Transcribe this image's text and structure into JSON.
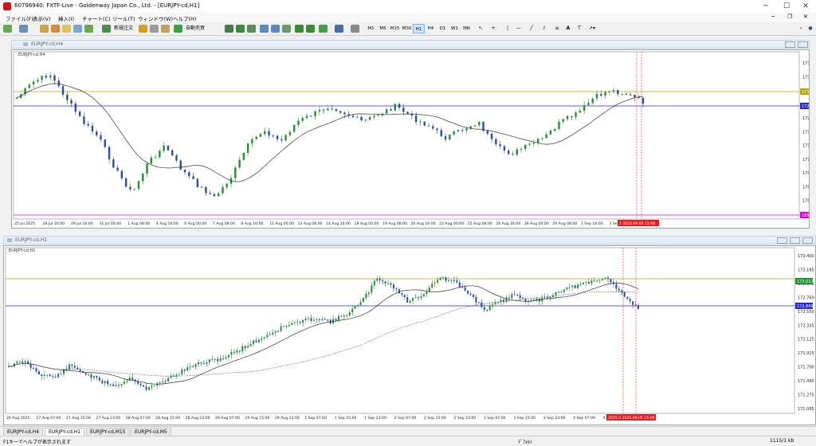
{
  "window": {
    "title": "60796940: FXTF-Live - Goldenway Japan Co., Ltd. - [EURJPY-cd,H1]",
    "minimize": "─",
    "maximize": "☐",
    "close": "✕"
  },
  "menu": [
    "ファイル(F)",
    "表示(V)",
    "挿入(I)",
    "チャート(C)",
    "ツール(T)",
    "ウィンドウ(W)",
    "ヘルプ(H)"
  ],
  "toolbar": {
    "new_order": "新規注文",
    "auto_trading": "自動売買",
    "timeframes": [
      "M1",
      "M5",
      "M15",
      "M30",
      "H1",
      "H4",
      "D1",
      "W1",
      "MN"
    ],
    "active_timeframe": "H1"
  },
  "top_window": {
    "mdi_title": "EURJPY-cd,H4",
    "chart_label": "EURJPY-cd,H4",
    "price_labels": [
      "173.40",
      "173.15",
      "172.80",
      "172.50",
      "172.20",
      "171.90",
      "171.55",
      "171.20",
      "170.90",
      "170.55",
      "170.25",
      "169.90"
    ],
    "time_labels": [
      "25 Jul 2025",
      "28 Jul 16:00",
      "29 Jul 16:00",
      "31 Jul 00:00",
      "1 Aug 08:00",
      "4 Aug 16:00",
      "6 Aug 00:00",
      "7 Aug 08:00",
      "8 Aug 16:00",
      "12 Aug 00:00",
      "13 Aug 08:00",
      "14 Aug 16:00",
      "18 Aug 00:00",
      "19 Aug 08:00",
      "20 Aug 16:00",
      "22 Aug 00:00",
      "25 Aug 08:00",
      "26 Aug 16:00",
      "28 Aug 00:00",
      "29 Aug 08:00",
      "1 Sep 16:00",
      "3 Sep 00:00",
      "4 Sep 08:00"
    ],
    "tags": {
      "yellow": "173.0",
      "blue": "172.6",
      "magenta": "169.7"
    },
    "time_marker": "2 2025.09.05 15:00"
  },
  "bottom_window": {
    "mdi_title": "EURJPY-cd,H1",
    "chart_label": "EURJPY-cd,H1",
    "price_labels": [
      "173.400",
      "173.185",
      "172.975",
      "172.760",
      "172.550",
      "172.335",
      "172.125",
      "171.915",
      "171.700",
      "171.490",
      "171.275",
      "171.065"
    ],
    "time_labels": [
      "26 Aug 2025",
      "27 Aug 07:00",
      "27 Aug 15:00",
      "27 Aug 23:00",
      "28 Aug 07:00",
      "28 Aug 15:00",
      "28 Aug 23:00",
      "29 Aug 07:00",
      "29 Aug 15:00",
      "29 Aug 23:00",
      "1 Sep 07:00",
      "1 Sep 15:00",
      "1 Sep 23:00",
      "2 Sep 07:00",
      "2 Sep 15:00",
      "2 Sep 23:00",
      "3 Sep 07:00",
      "3 Sep 15:00",
      "3 Sep 23:00",
      "4 Sep 07:00",
      "4 Sep 15:00",
      "4 Sep 23:00"
    ],
    "tags": {
      "green": "173.011",
      "blue": "172.849"
    },
    "time_marker": "2025.0 2025.09.05 15:00"
  },
  "tabs": [
    "EURJPY-cd,H4",
    "EURJPY-cd,H1",
    "EURJPY-cd,M15",
    "EURJPY-cd,M5"
  ],
  "active_tab": "EURJPY-cd,H1",
  "status": {
    "help": "F1キーでヘルプが表示されます",
    "profile": "ﾃﾞﾌｫﾙﾄ",
    "traffic": "1115/1 kb"
  },
  "colors": {
    "bull": "#1f8f2f",
    "bear": "#2a4fa0",
    "ma": "#333333",
    "yellow_line": "#b5a800",
    "blue_line": "#2a2ad4",
    "magenta_line": "#e000e0",
    "marker": "#e02020"
  }
}
